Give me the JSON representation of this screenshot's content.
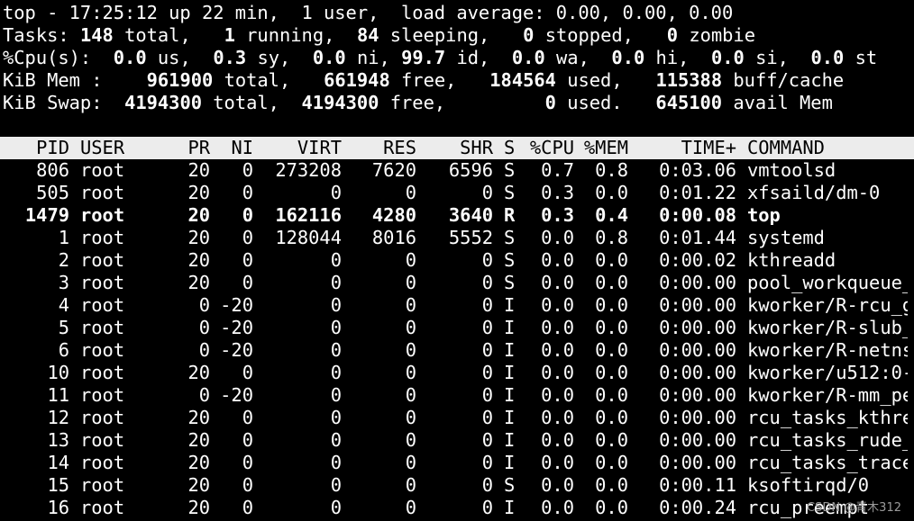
{
  "summary": {
    "uptime_line": "top - 17:25:12 up 22 min,  1 user,  load average: 0.00, 0.00, 0.00",
    "tasks": {
      "label": "Tasks:",
      "total": "148",
      "total_label": "total,",
      "running": "1",
      "running_label": "running,",
      "sleeping": "84",
      "sleeping_label": "sleeping,",
      "stopped": "0",
      "stopped_label": "stopped,",
      "zombie": "0",
      "zombie_label": "zombie"
    },
    "cpu": {
      "label": "%Cpu(s):",
      "us": "0.0",
      "us_label": "us,",
      "sy": "0.3",
      "sy_label": "sy,",
      "ni": "0.0",
      "ni_label": "ni,",
      "id": "99.7",
      "id_label": "id,",
      "wa": "0.0",
      "wa_label": "wa,",
      "hi": "0.0",
      "hi_label": "hi,",
      "si": "0.0",
      "si_label": "si,",
      "st": "0.0",
      "st_label": "st"
    },
    "mem": {
      "label": "KiB Mem :",
      "total": "961900",
      "total_label": "total,",
      "free": "661948",
      "free_label": "free,",
      "used": "184564",
      "used_label": "used,",
      "buff_cache": "115388",
      "buff_cache_label": "buff/cache"
    },
    "swap": {
      "label": "KiB Swap:",
      "total": "4194300",
      "total_label": "total,",
      "free": "4194300",
      "free_label": "free,",
      "used": "0",
      "used_label": "used.",
      "avail": "645100",
      "avail_label": "avail Mem"
    }
  },
  "table": {
    "headers": {
      "pid": "PID",
      "user": "USER",
      "pr": "PR",
      "ni": "NI",
      "virt": "VIRT",
      "res": "RES",
      "shr": "SHR",
      "s": "S",
      "cpu": "%CPU",
      "mem": "%MEM",
      "time": "TIME+",
      "command": "COMMAND"
    },
    "rows": [
      {
        "pid": "806",
        "user": "root",
        "pr": "20",
        "ni": "0",
        "virt": "273208",
        "res": "7620",
        "shr": "6596",
        "s": "S",
        "cpu": "0.7",
        "mem": "0.8",
        "time": "0:03.06",
        "command": "vmtoolsd"
      },
      {
        "pid": "505",
        "user": "root",
        "pr": "20",
        "ni": "0",
        "virt": "0",
        "res": "0",
        "shr": "0",
        "s": "S",
        "cpu": "0.3",
        "mem": "0.0",
        "time": "0:01.22",
        "command": "xfsaild/dm-0"
      },
      {
        "pid": "1479",
        "user": "root",
        "pr": "20",
        "ni": "0",
        "virt": "162116",
        "res": "4280",
        "shr": "3640",
        "s": "R",
        "cpu": "0.3",
        "mem": "0.4",
        "time": "0:00.08",
        "command": "top"
      },
      {
        "pid": "1",
        "user": "root",
        "pr": "20",
        "ni": "0",
        "virt": "128044",
        "res": "8016",
        "shr": "5552",
        "s": "S",
        "cpu": "0.0",
        "mem": "0.8",
        "time": "0:01.44",
        "command": "systemd"
      },
      {
        "pid": "2",
        "user": "root",
        "pr": "20",
        "ni": "0",
        "virt": "0",
        "res": "0",
        "shr": "0",
        "s": "S",
        "cpu": "0.0",
        "mem": "0.0",
        "time": "0:00.02",
        "command": "kthreadd"
      },
      {
        "pid": "3",
        "user": "root",
        "pr": "20",
        "ni": "0",
        "virt": "0",
        "res": "0",
        "shr": "0",
        "s": "S",
        "cpu": "0.0",
        "mem": "0.0",
        "time": "0:00.00",
        "command": "pool_workqueue_"
      },
      {
        "pid": "4",
        "user": "root",
        "pr": "0",
        "ni": "-20",
        "virt": "0",
        "res": "0",
        "shr": "0",
        "s": "I",
        "cpu": "0.0",
        "mem": "0.0",
        "time": "0:00.00",
        "command": "kworker/R-rcu_g"
      },
      {
        "pid": "5",
        "user": "root",
        "pr": "0",
        "ni": "-20",
        "virt": "0",
        "res": "0",
        "shr": "0",
        "s": "I",
        "cpu": "0.0",
        "mem": "0.0",
        "time": "0:00.00",
        "command": "kworker/R-slub_"
      },
      {
        "pid": "6",
        "user": "root",
        "pr": "0",
        "ni": "-20",
        "virt": "0",
        "res": "0",
        "shr": "0",
        "s": "I",
        "cpu": "0.0",
        "mem": "0.0",
        "time": "0:00.00",
        "command": "kworker/R-netns"
      },
      {
        "pid": "10",
        "user": "root",
        "pr": "20",
        "ni": "0",
        "virt": "0",
        "res": "0",
        "shr": "0",
        "s": "I",
        "cpu": "0.0",
        "mem": "0.0",
        "time": "0:00.00",
        "command": "kworker/u512:0-"
      },
      {
        "pid": "11",
        "user": "root",
        "pr": "0",
        "ni": "-20",
        "virt": "0",
        "res": "0",
        "shr": "0",
        "s": "I",
        "cpu": "0.0",
        "mem": "0.0",
        "time": "0:00.00",
        "command": "kworker/R-mm_pe"
      },
      {
        "pid": "12",
        "user": "root",
        "pr": "20",
        "ni": "0",
        "virt": "0",
        "res": "0",
        "shr": "0",
        "s": "I",
        "cpu": "0.0",
        "mem": "0.0",
        "time": "0:00.00",
        "command": "rcu_tasks_kthre"
      },
      {
        "pid": "13",
        "user": "root",
        "pr": "20",
        "ni": "0",
        "virt": "0",
        "res": "0",
        "shr": "0",
        "s": "I",
        "cpu": "0.0",
        "mem": "0.0",
        "time": "0:00.00",
        "command": "rcu_tasks_rude_"
      },
      {
        "pid": "14",
        "user": "root",
        "pr": "20",
        "ni": "0",
        "virt": "0",
        "res": "0",
        "shr": "0",
        "s": "I",
        "cpu": "0.0",
        "mem": "0.0",
        "time": "0:00.00",
        "command": "rcu_tasks_trace"
      },
      {
        "pid": "15",
        "user": "root",
        "pr": "20",
        "ni": "0",
        "virt": "0",
        "res": "0",
        "shr": "0",
        "s": "S",
        "cpu": "0.0",
        "mem": "0.0",
        "time": "0:00.11",
        "command": "ksoftirqd/0"
      },
      {
        "pid": "16",
        "user": "root",
        "pr": "20",
        "ni": "0",
        "virt": "0",
        "res": "0",
        "shr": "0",
        "s": "I",
        "cpu": "0.0",
        "mem": "0.0",
        "time": "0:00.24",
        "command": "rcu_preempt"
      }
    ],
    "highlighted_pid": "1479"
  },
  "watermark": "CSDN @青木312",
  "colors": {
    "background": "#000000",
    "text": "#ffffff",
    "header_bg": "#ececec",
    "header_text": "#000000"
  }
}
